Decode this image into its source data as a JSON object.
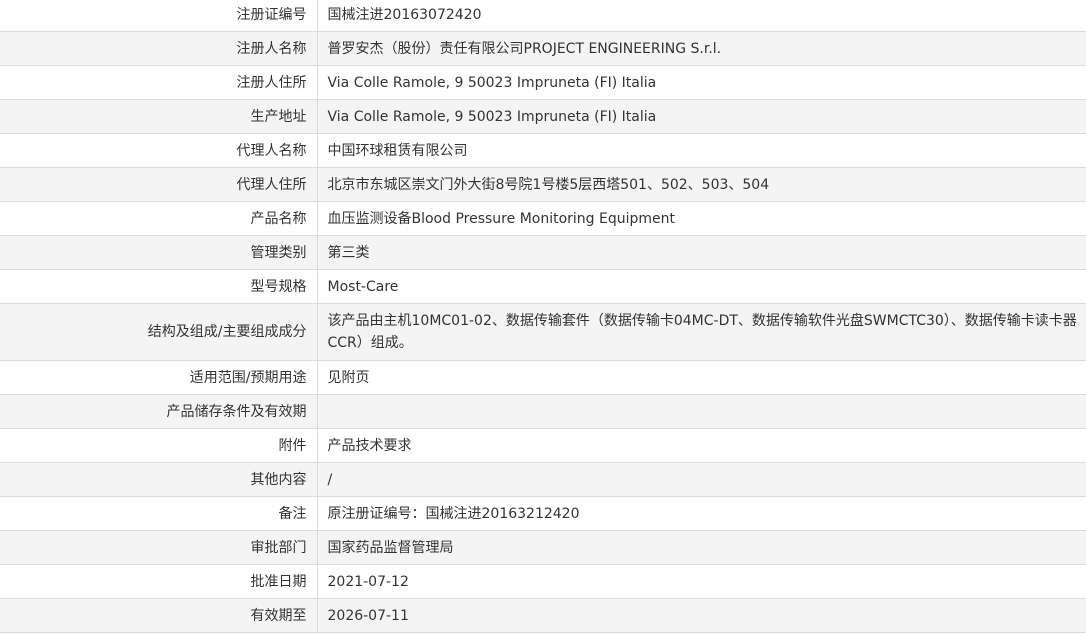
{
  "rows": [
    {
      "label": "注册证编号",
      "value": "国械注进20163072420"
    },
    {
      "label": "注册人名称",
      "value": "普罗安杰（股份）责任有限公司PROJECT ENGINEERING S.r.l."
    },
    {
      "label": "注册人住所",
      "value": "Via Colle Ramole, 9 50023 Impruneta (FI) Italia"
    },
    {
      "label": "生产地址",
      "value": "Via Colle Ramole, 9 50023 Impruneta (FI) Italia"
    },
    {
      "label": "代理人名称",
      "value": "中国环球租赁有限公司"
    },
    {
      "label": "代理人住所",
      "value": "北京市东城区崇文门外大街8号院1号楼5层西塔501、502、503、504"
    },
    {
      "label": "产品名称",
      "value": "血压监测设备Blood Pressure Monitoring Equipment"
    },
    {
      "label": "管理类别",
      "value": "第三类"
    },
    {
      "label": "型号规格",
      "value": "Most-Care"
    },
    {
      "label": "结构及组成/主要组成成分",
      "value": "该产品由主机10MC01-02、数据传输套件（数据传输卡04MC-DT、数据传输软件光盘SWMCTC30）、数据传输卡读卡器CCR）组成。"
    },
    {
      "label": "适用范围/预期用途",
      "value": "见附页"
    },
    {
      "label": "产品储存条件及有效期",
      "value": ""
    },
    {
      "label": "附件",
      "value": "产品技术要求"
    },
    {
      "label": "其他内容",
      "value": "/"
    },
    {
      "label": "备注",
      "value": "原注册证编号：国械注进20163212420"
    },
    {
      "label": "审批部门",
      "value": "国家药品监督管理局"
    },
    {
      "label": "批准日期",
      "value": "2021-07-12"
    },
    {
      "label": "有效期至",
      "value": "2026-07-11"
    }
  ]
}
